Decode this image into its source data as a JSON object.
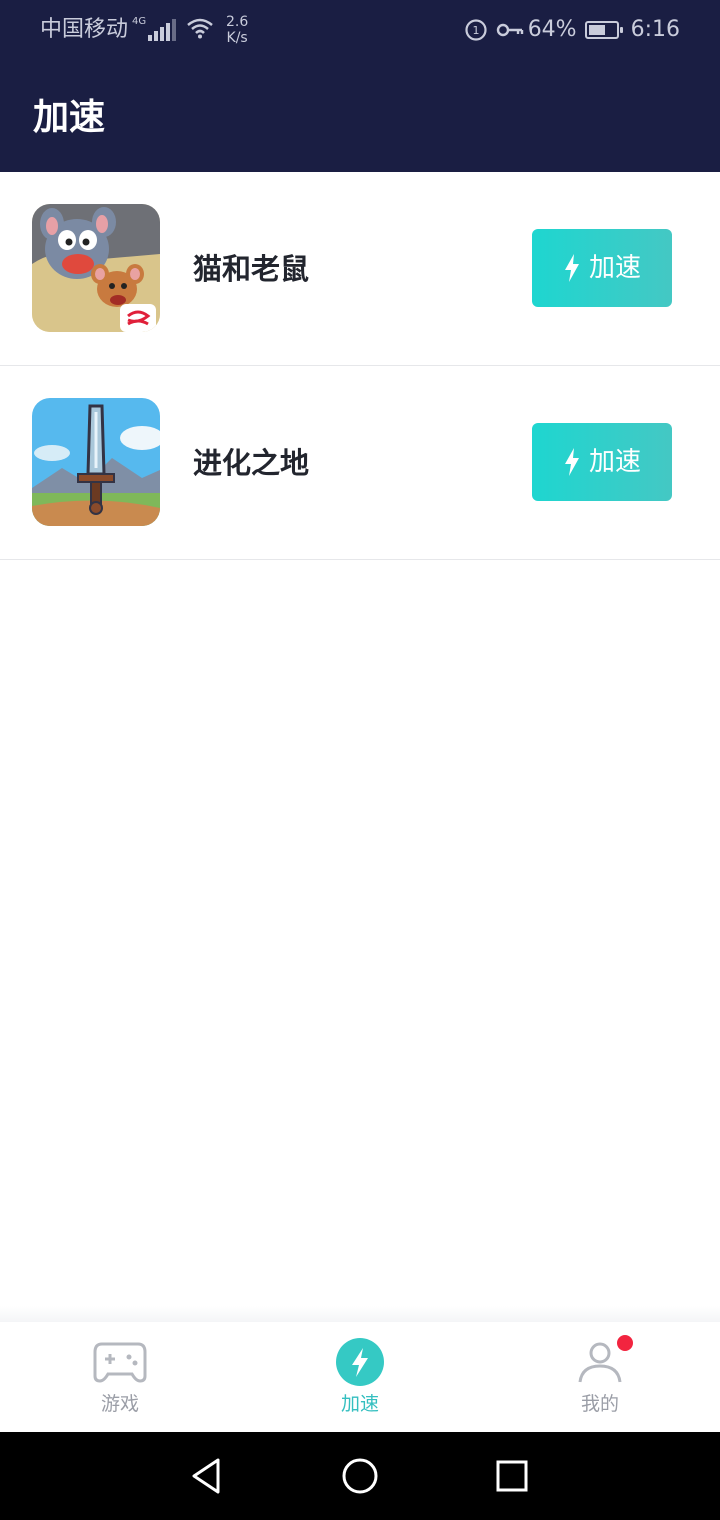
{
  "status_bar": {
    "carrier": "中国移动",
    "network_type": "4G",
    "speed_value": "2.6",
    "speed_unit": "K/s",
    "battery_percent": "64%",
    "battery_level": 0.64,
    "time": "6:16"
  },
  "header": {
    "title": "加速"
  },
  "games": [
    {
      "name": "猫和老鼠",
      "button_label": "加速",
      "icon": "tom-and-jerry-icon"
    },
    {
      "name": "进化之地",
      "button_label": "加速",
      "icon": "evoland-sword-icon"
    }
  ],
  "bottom_nav": {
    "tabs": [
      {
        "label": "游戏",
        "icon": "gamepad-icon",
        "active": false
      },
      {
        "label": "加速",
        "icon": "lightning-icon",
        "active": true
      },
      {
        "label": "我的",
        "icon": "person-icon",
        "active": false,
        "badge": true
      }
    ]
  },
  "system_nav": {
    "buttons": [
      "back-icon",
      "home-icon",
      "recents-icon"
    ]
  },
  "colors": {
    "header_bg": "#1a1e43",
    "accent": "#2fd0cb",
    "active_tab": "#35bfc0",
    "badge": "#f2243f"
  }
}
